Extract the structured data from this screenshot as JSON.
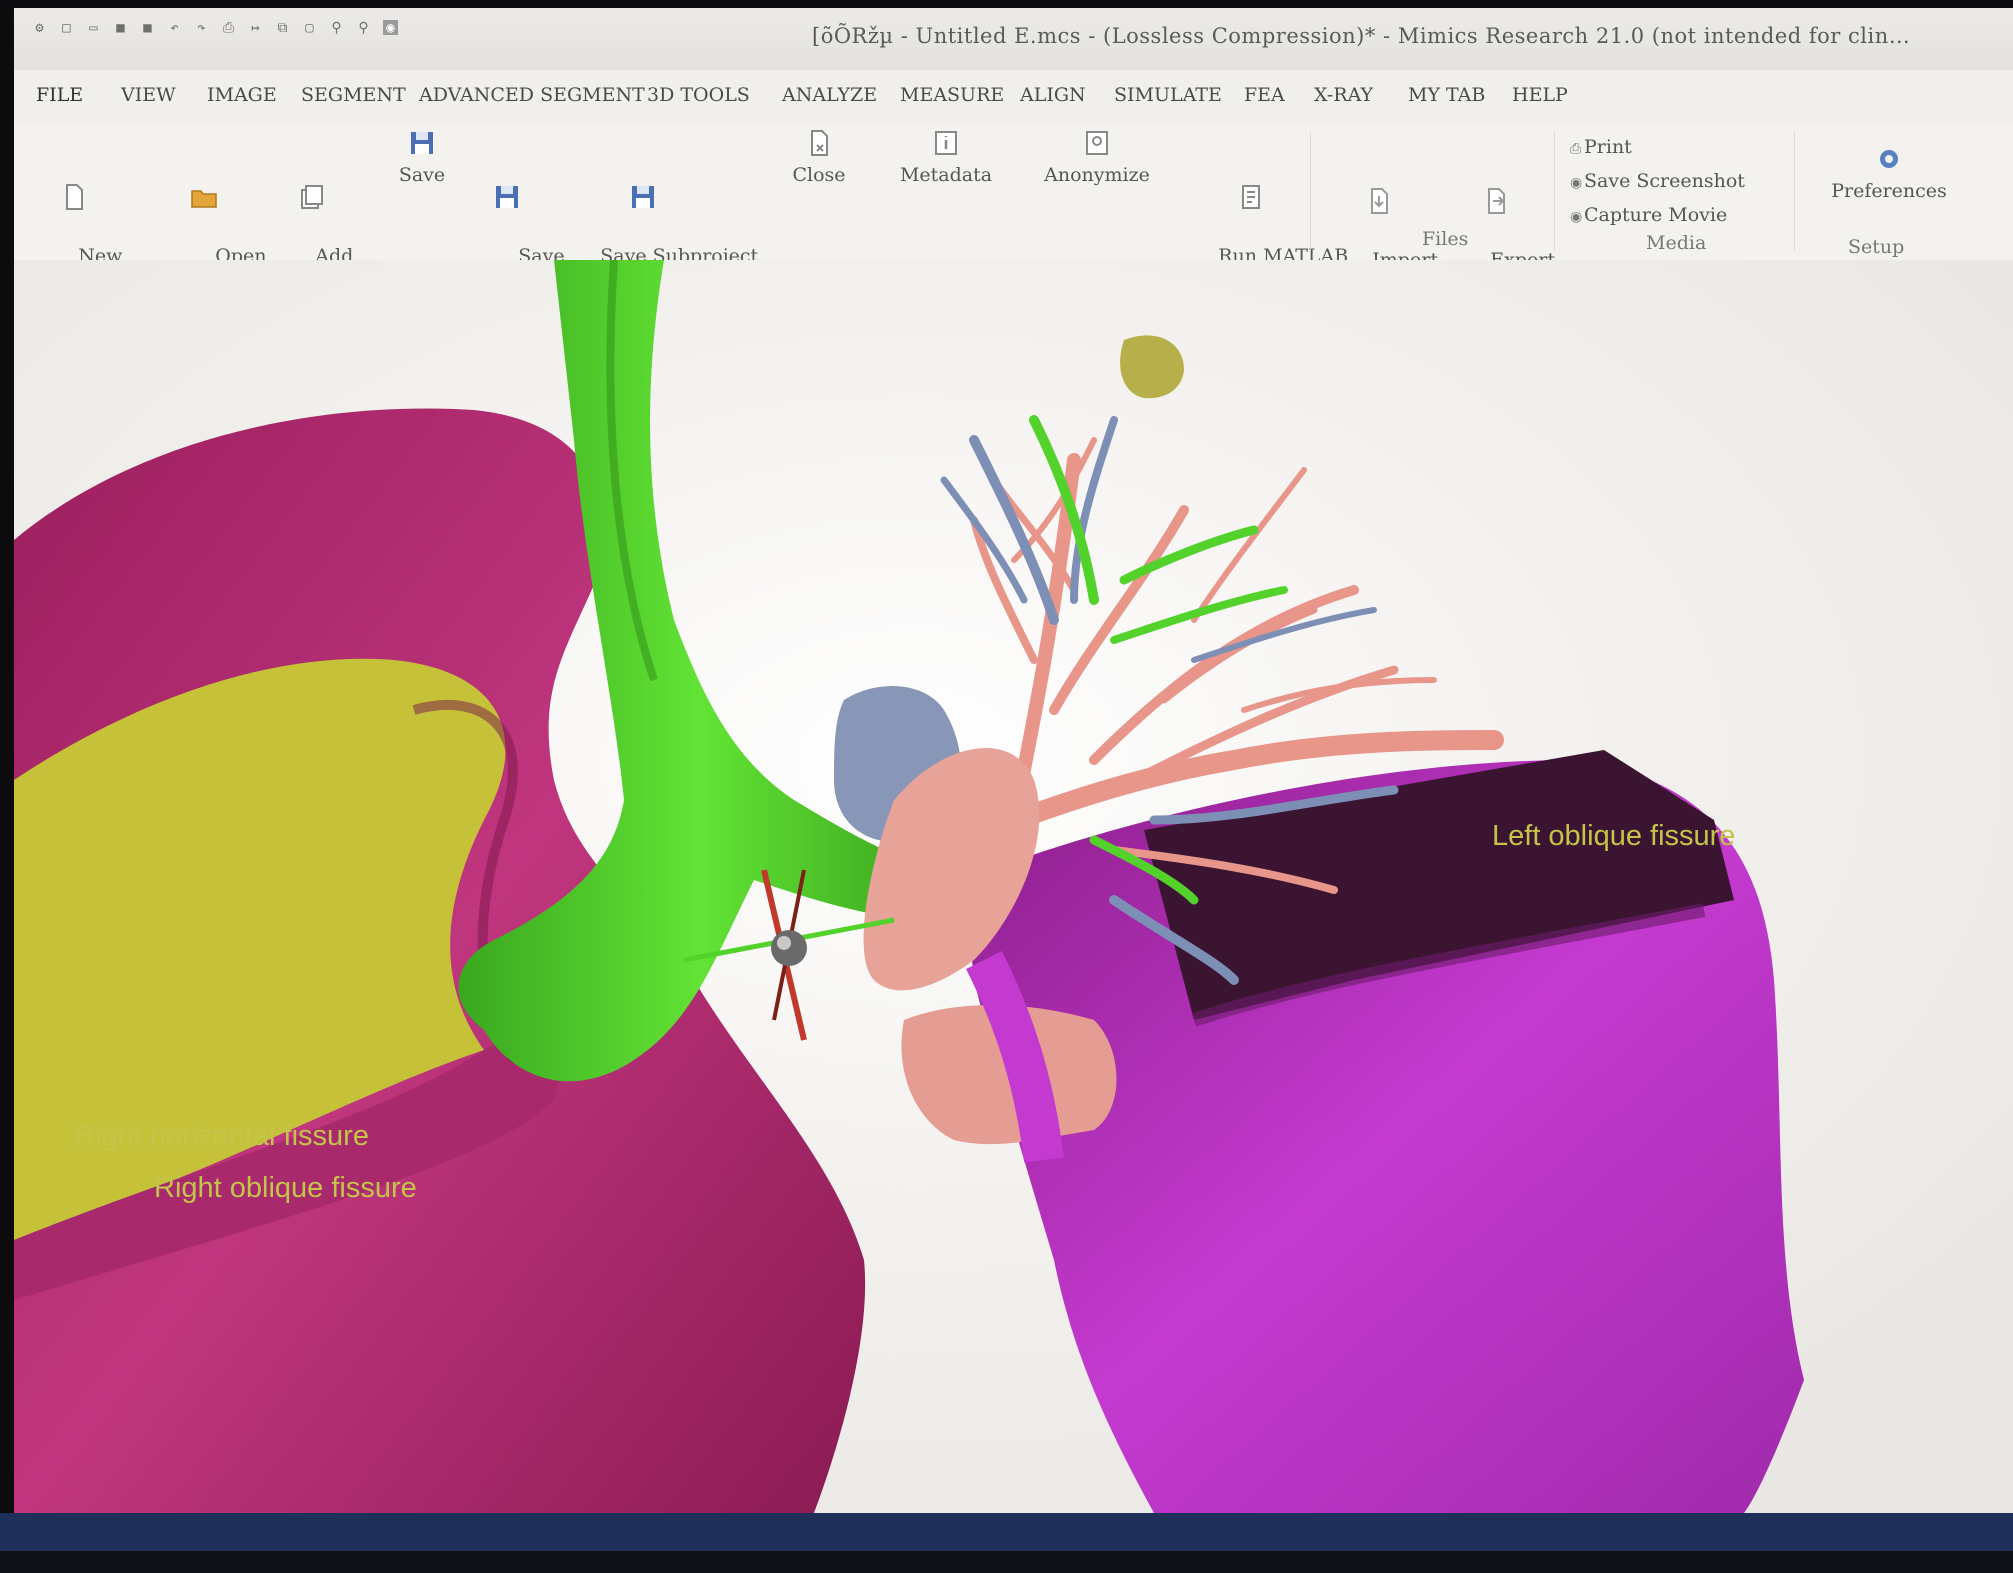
{
  "window": {
    "title": "[õÕRžµ - Untitled E.mcs - (Lossless Compression)* - Mimics Research 21.0 (not intended for clin…"
  },
  "quick_access": [
    "app-icon",
    "new-icon",
    "open-icon",
    "save-icon",
    "save-all-icon",
    "undo-icon",
    "redo-icon",
    "print-icon",
    "export-icon",
    "copy-icon",
    "paste-icon",
    "zoom-in-icon",
    "zoom-out-icon",
    "screenshot-icon"
  ],
  "menu": [
    {
      "label": "FILE"
    },
    {
      "label": "VIEW"
    },
    {
      "label": "IMAGE"
    },
    {
      "label": "SEGMENT"
    },
    {
      "label": "ADVANCED SEGMENT"
    },
    {
      "label": "3D TOOLS"
    },
    {
      "label": "ANALYZE"
    },
    {
      "label": "MEASURE"
    },
    {
      "label": "ALIGN"
    },
    {
      "label": "SIMULATE"
    },
    {
      "label": "FEA"
    },
    {
      "label": "X-RAY"
    },
    {
      "label": "MY TAB"
    },
    {
      "label": "HELP"
    }
  ],
  "ribbon": {
    "new_project": "New\nProject",
    "open": "Open\n·",
    "add_images": "Add\nImages",
    "save": "Save",
    "save_as": "Save\nAs",
    "save_subproject": "Save Subproject\nAs\nProject",
    "close": "Close",
    "metadata": "Metadata",
    "anonymize": "Anonymize",
    "run_matlab": "Run MATLAB\nScript",
    "import": "Import\n·",
    "export": "Export\n·",
    "print": "Print",
    "save_screenshot": "Save Screenshot",
    "capture_movie": "Capture Movie",
    "preferences": "Preferences",
    "groups": {
      "files": "Files",
      "media": "Media",
      "setup": "Setup"
    }
  },
  "viewport": {
    "annotations": {
      "left_oblique": "Left oblique fissure",
      "right_horizontal": "Right horizontal fissure",
      "right_oblique": "Right oblique fissure"
    }
  },
  "colors": {
    "right_lung": "#b52a73",
    "left_lung": "#b028b8",
    "trachea": "#4fcf2a",
    "vessels_pink": "#e89a8c",
    "vessels_blue": "#7e8fb6",
    "fissure_yellow": "#c7c43b",
    "annotation_text": "#c4c44a"
  }
}
